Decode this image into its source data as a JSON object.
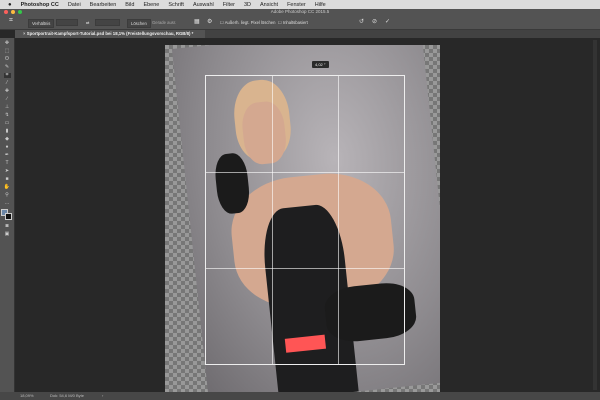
{
  "menu": {
    "apple": "",
    "app": "Photoshop CC",
    "items": [
      "Datei",
      "Bearbeiten",
      "Bild",
      "Ebene",
      "Schrift",
      "Auswahl",
      "Filter",
      "3D",
      "Ansicht",
      "Fenster",
      "Hilfe"
    ]
  },
  "window_title": "Adobe Photoshop CC 2015.5",
  "options": {
    "ratio": "Verhältnis",
    "clear": "Löschen",
    "straighten": "Gerade ausr.",
    "delete_cropped": "Außerh. liegt. Pixel löschen",
    "content_aware": "Inhaltsbasiert"
  },
  "tab": {
    "title": "Sportportrait-Kampfsport-Tutorial.psd bei 18,1% (Freistellungsvorschau, RGB/8) *"
  },
  "canvas": {
    "angle_readout": "4,02 °"
  },
  "status": {
    "zoom": "18,09%",
    "doc": "Dok: 54,6 M/0 Byte"
  },
  "colors": {
    "accent": "#ff5555"
  }
}
